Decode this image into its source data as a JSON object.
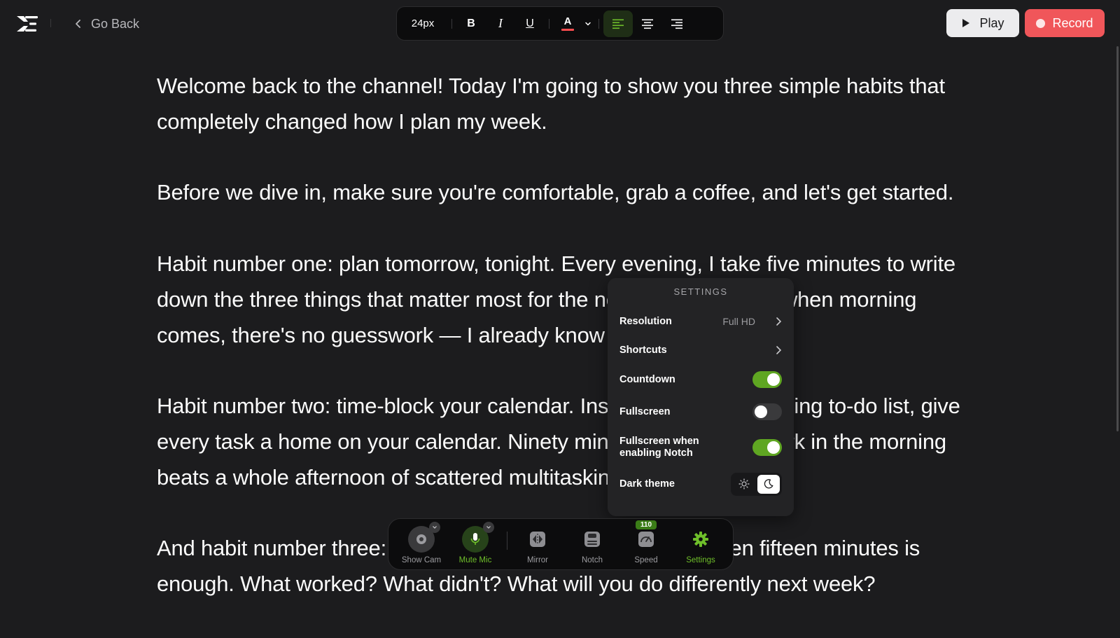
{
  "header": {
    "back_label": "Go Back",
    "play_label": "Play",
    "record_label": "Record"
  },
  "toolbar": {
    "font_size": "24px",
    "bold_label": "B",
    "italic_label": "I",
    "underline_label": "U",
    "text_color_label": "A",
    "text_color": "#ff4d4f",
    "alignment": "left"
  },
  "script": {
    "paragraphs": [
      "Welcome back to the channel! Today I'm going to show you three simple habits that completely changed how I plan my week.",
      "Before we dive in, make sure you're comfortable, grab a coffee, and let's get started.",
      "Habit number one: plan tomorrow, tonight. Every evening, I take five minutes to write down the three things that matter most for the next day. That way, when morning comes, there's no guesswork — I already know exactly what to do.",
      "Habit number two: time-block your calendar. Instead of a never-ending to-do list, give every task a home on your calendar. Ninety minutes of focused work in the morning beats a whole afternoon of scattered multitasking.",
      "And habit number three: review your week every Sunday. Even fifteen minutes is enough. What worked? What didn't? What will you do differently next week?"
    ]
  },
  "settings": {
    "title": "SETTINGS",
    "resolution_label": "Resolution",
    "resolution_value": "Full HD",
    "shortcuts_label": "Shortcuts",
    "countdown_label": "Countdown",
    "countdown_on": true,
    "fullscreen_label": "Fullscreen",
    "fullscreen_on": false,
    "fullscreen_notch_label": "Fullscreen when enabling Notch",
    "fullscreen_notch_on": true,
    "dark_theme_label": "Dark theme",
    "theme": "dark"
  },
  "dock": {
    "show_cam_label": "Show Cam",
    "mute_mic_label": "Mute Mic",
    "mirror_label": "Mirror",
    "notch_label": "Notch",
    "speed_label": "Speed",
    "speed_value": "110",
    "settings_label": "Settings"
  },
  "colors": {
    "accent_green": "#6fbf2a",
    "record_red": "#f0565a",
    "background": "#1c1c1e"
  },
  "icons": [
    "app-logo-icon",
    "chevron-left-icon",
    "play-icon",
    "record-dot-icon",
    "align-left-icon",
    "align-center-icon",
    "align-right-icon",
    "camera-icon",
    "microphone-icon",
    "mirror-icon",
    "notch-icon",
    "speedometer-icon",
    "gear-icon",
    "sun-icon",
    "moon-icon"
  ]
}
